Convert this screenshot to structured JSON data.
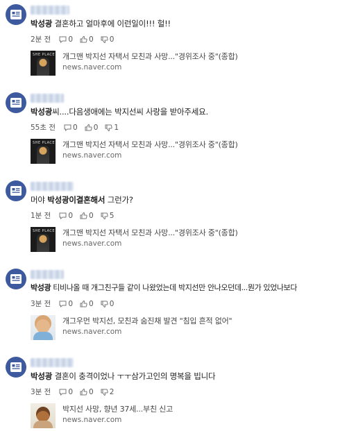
{
  "comments": [
    {
      "text": "박성광 결혼하고 얼마후에 이런일이!!! 헐!!",
      "bold": "",
      "time": "2분 전",
      "replies": "0",
      "likes": "0",
      "dislikes": "0",
      "link": null
    },
    {
      "bold": "박성광",
      "text": "씨....다음생애에는 박지선씨 사랑을 받아주세요.",
      "time": "55초 전",
      "replies": "0",
      "likes": "0",
      "dislikes": "1",
      "link": {
        "title": "개그맨 박지선 자택서 모친과 사망...\"경위조사 중\"(종합)",
        "domain": "news.naver.com",
        "thumb_text": "SHE PLACE"
      }
    },
    {
      "pre": "머야 ",
      "bold": "박성광이결혼해서",
      "text": " 그런가?",
      "time": "1분 전",
      "replies": "0",
      "likes": "0",
      "dislikes": "5",
      "link": {
        "title": "개그맨 박지선 자택서 모친과 사망...\"경위조사 중\"(종합)",
        "domain": "news.naver.com",
        "thumb_text": "SHE PLACE"
      }
    },
    {
      "bold": "박성광",
      "text": " 티비나올 때 개그친구들 같이 나왔었는데 박지선만 안나오던데...뭔가 있었나보다",
      "time": "3분 전",
      "replies": "0",
      "likes": "0",
      "dislikes": "0",
      "link": {
        "title": "개그우먼 박지선, 모친과 숨진채 발견 \"침입 흔적 없어\"",
        "domain": "news.naver.com"
      }
    },
    {
      "bold": "박성광",
      "text": " 결혼이 충격이었나 ㅜㅜ삼가고인의 명복을 빕니다",
      "time": "3분 전",
      "replies": "0",
      "likes": "0",
      "dislikes": "2",
      "link": {
        "title": "박지선 사망, 향년 37세...부친 신고",
        "domain": "news.naver.com"
      }
    }
  ],
  "first_comment": {
    "bold": "박성광",
    "text": " 결혼하고 얼마후에 이런일이!!! 헐!!",
    "link": {
      "title": "개그맨 박지선 자택서 모친과 사망...\"경위조사 중\"(종합)",
      "domain": "news.naver.com",
      "thumb_text": "SHE PLACE"
    }
  },
  "colors": {
    "avatar": "#3d5a9e",
    "text": "#1f1f1f",
    "meta": "#555555"
  }
}
